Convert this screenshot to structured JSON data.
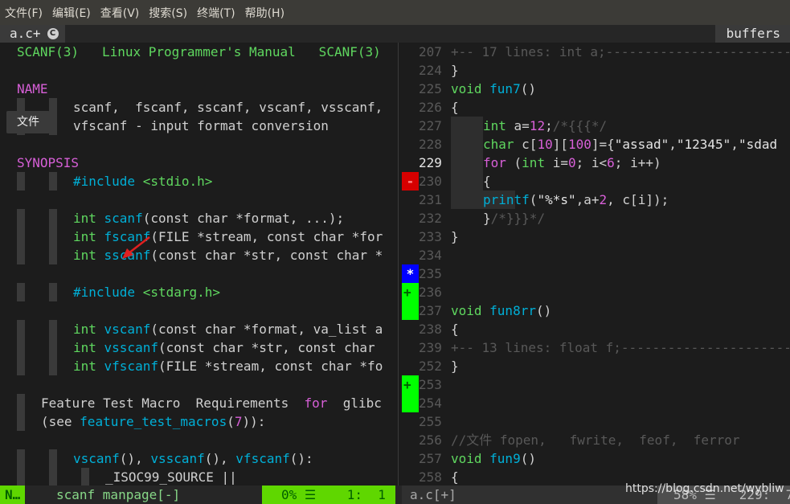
{
  "menu": [
    "文件(F)",
    "编辑(E)",
    "查看(V)",
    "搜索(S)",
    "终端(T)",
    "帮助(H)"
  ],
  "tabline": {
    "active_tab": "a.c+",
    "badge": "C",
    "buffers_label": "buffers"
  },
  "tooltip": "文件",
  "man": {
    "header": "SCANF(3)   Linux Programmer's Manual   SCANF(3)",
    "name_section": "NAME",
    "name_line1": "scanf,  fscanf, sscanf, vscanf, vsscanf,",
    "name_line2": "vfscanf - input format conversion",
    "synopsis_section": "SYNOPSIS",
    "include1_kw": "#include",
    "include1_hdr": " <stdio.h>",
    "sig1_int": "int ",
    "sig1_fn": "scanf",
    "sig1_rest": "(const char *format, ...);",
    "sig2_int": "int ",
    "sig2_fn": "fscanf",
    "sig2_rest": "(FILE *stream, const char *for",
    "sig3_int": "int ",
    "sig3_fn": "sscanf",
    "sig3_rest": "(const char *str, const char *",
    "include2_kw": "#include",
    "include2_hdr": " <stdarg.h>",
    "sig4_int": "int ",
    "sig4_fn": "vscanf",
    "sig4_rest": "(const char *format, va_list a",
    "sig5_int": "int ",
    "sig5_fn": "vsscanf",
    "sig5_rest": "(const char *str, const char ",
    "sig6_int": "int ",
    "sig6_fn": "vfscanf",
    "sig6_rest": "(FILE *stream, const char *fo",
    "ftm_a": "Feature Test Macro  Requirements  ",
    "ftm_for": "for",
    "ftm_b": "  glibc",
    "see_a": "(see ",
    "see_link": "feature_test_macros",
    "see_b": "(",
    "see_num": "7",
    "see_c": ")):",
    "fnlist_a": "vscanf",
    "fnlist_b": "(), ",
    "fnlist_c": "vsscanf",
    "fnlist_d": "(), ",
    "fnlist_e": "vfscanf",
    "fnlist_f": "():",
    "isoline": "_ISOC99_SOURCE ||"
  },
  "code": {
    "l207": "207",
    "fold1": "+-- 17 lines: int a;---------------------------",
    "l224": "224",
    "brace_close1": "}",
    "l225": "225",
    "void1": "void",
    "fun7": " fun7",
    "paren1": "()",
    "l226": "226",
    "brace_open1": "{",
    "l227": "227",
    "int_a": "int",
    "a_assign": " a=",
    "a_val": "12",
    "a_semi": ";",
    "a_cmt": "/*{{{*/",
    "l228": "228",
    "char_kw": "char",
    "char_rest": " c[",
    "dim1": "10",
    "br1": "][",
    "dim2": "100",
    "br2": "]={",
    "s1": "\"assad\"",
    "comma1": ",",
    "s2": "\"12345\"",
    "comma2": ",",
    "s3": "\"sdad",
    "l229": "229",
    "for_kw": "for",
    "for_a": " (",
    "for_int": "int",
    "for_b": " i=",
    "for_z": "0",
    "for_c": "; i<",
    "for_six": "6",
    "for_d": "; i++)",
    "l230": "230",
    "brace_open2": "{",
    "l231": "231",
    "printf": "printf",
    "pf_a": "(",
    "pf_str": "\"%*s\"",
    "pf_b": ",a+",
    "pf_two": "2",
    "pf_c": ", c[i]);",
    "l232": "232",
    "close_cmt": "}",
    "close_cmt2": "/*}}}*/",
    "l233": "233",
    "brace_close2": "}",
    "l234": "234",
    "l235": "235",
    "l236": "236",
    "l237": "237",
    "void2": "void",
    "fun8rr": " fun8rr",
    "paren2": "()",
    "l238": "238",
    "brace_open3": "{",
    "l239": "239",
    "fold2": "+-- 13 lines: float f;-------------------------",
    "l252": "252",
    "brace_close3": "}",
    "l253": "253",
    "l254": "254",
    "l255": "255",
    "l256": "256",
    "comment256": "//文件 fopen,   fwrite,  feof,  ferror",
    "l257": "257",
    "void3": "void",
    "fun9": " fun9",
    "paren3": "()",
    "l258": "258",
    "brace_open4": "{"
  },
  "signs": {
    "minus": "-",
    "star": "*",
    "plus1": "+",
    "plus2": "+"
  },
  "status": {
    "mode": "N…",
    "left_info": "scanf manpage[-]",
    "left_pct": "0% ☰    1:  1",
    "right_file": "a.c[+]",
    "right_pos": "58% ☰   229:  7"
  },
  "watermark": "https://blog.csdn.net/wybliw",
  "colors": {
    "mode_bg": "#5fd700",
    "keyword": "#00afd7",
    "section": "#d75fd7",
    "sign_minus": "#d70000",
    "sign_star": "#0000ff",
    "sign_plus": "#00ff00"
  }
}
